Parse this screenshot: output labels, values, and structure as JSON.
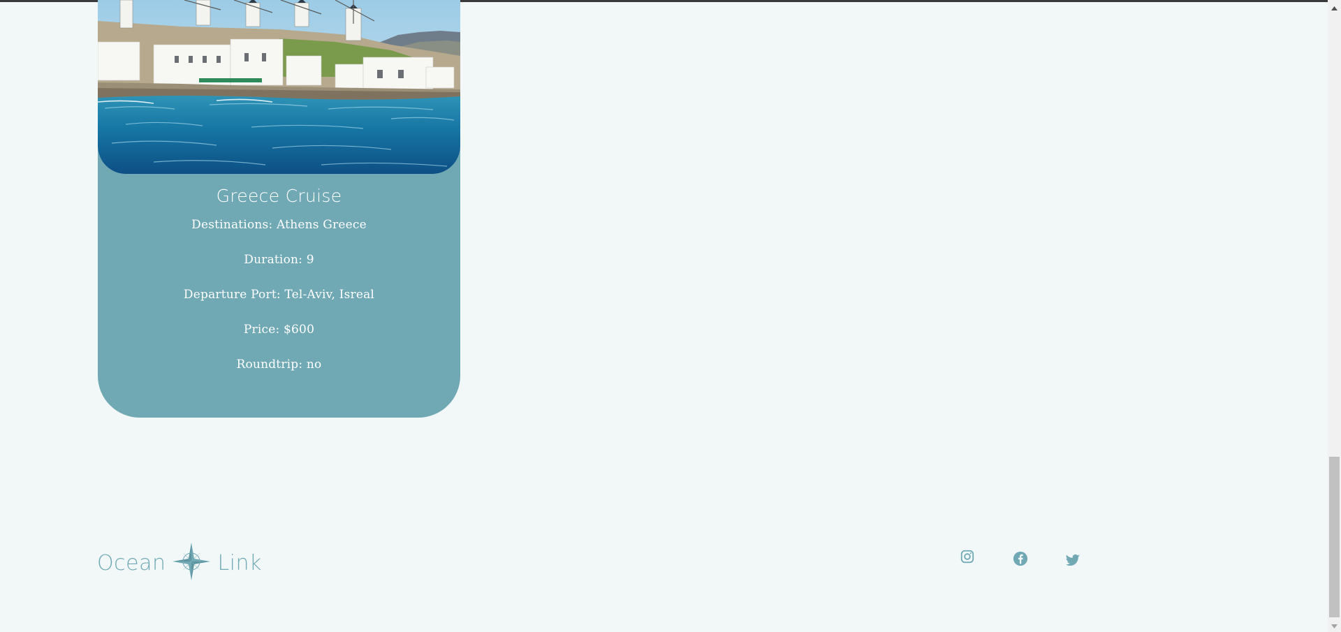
{
  "cruise_card": {
    "image_alt": "Windmills of Mykonos above a seaside village",
    "title": "Greece Cruise",
    "destinations": "Destinations: Athens Greece",
    "duration": "Duration: 9",
    "departure_port": "Departure Port: Tel-Aviv, Isreal",
    "price": "Price: $600",
    "roundtrip": "Roundtrip: no"
  },
  "footer": {
    "logo_left": "Ocean",
    "logo_right": "Link",
    "logo_icon": "compass-rose-icon",
    "social_icons": [
      "instagram-icon",
      "facebook-icon",
      "twitter-icon"
    ]
  },
  "colors": {
    "page_background": "#f2f8f8",
    "card_background": "#70a9b4",
    "accent": "#70a9b4",
    "card_text": "#ffffff"
  }
}
